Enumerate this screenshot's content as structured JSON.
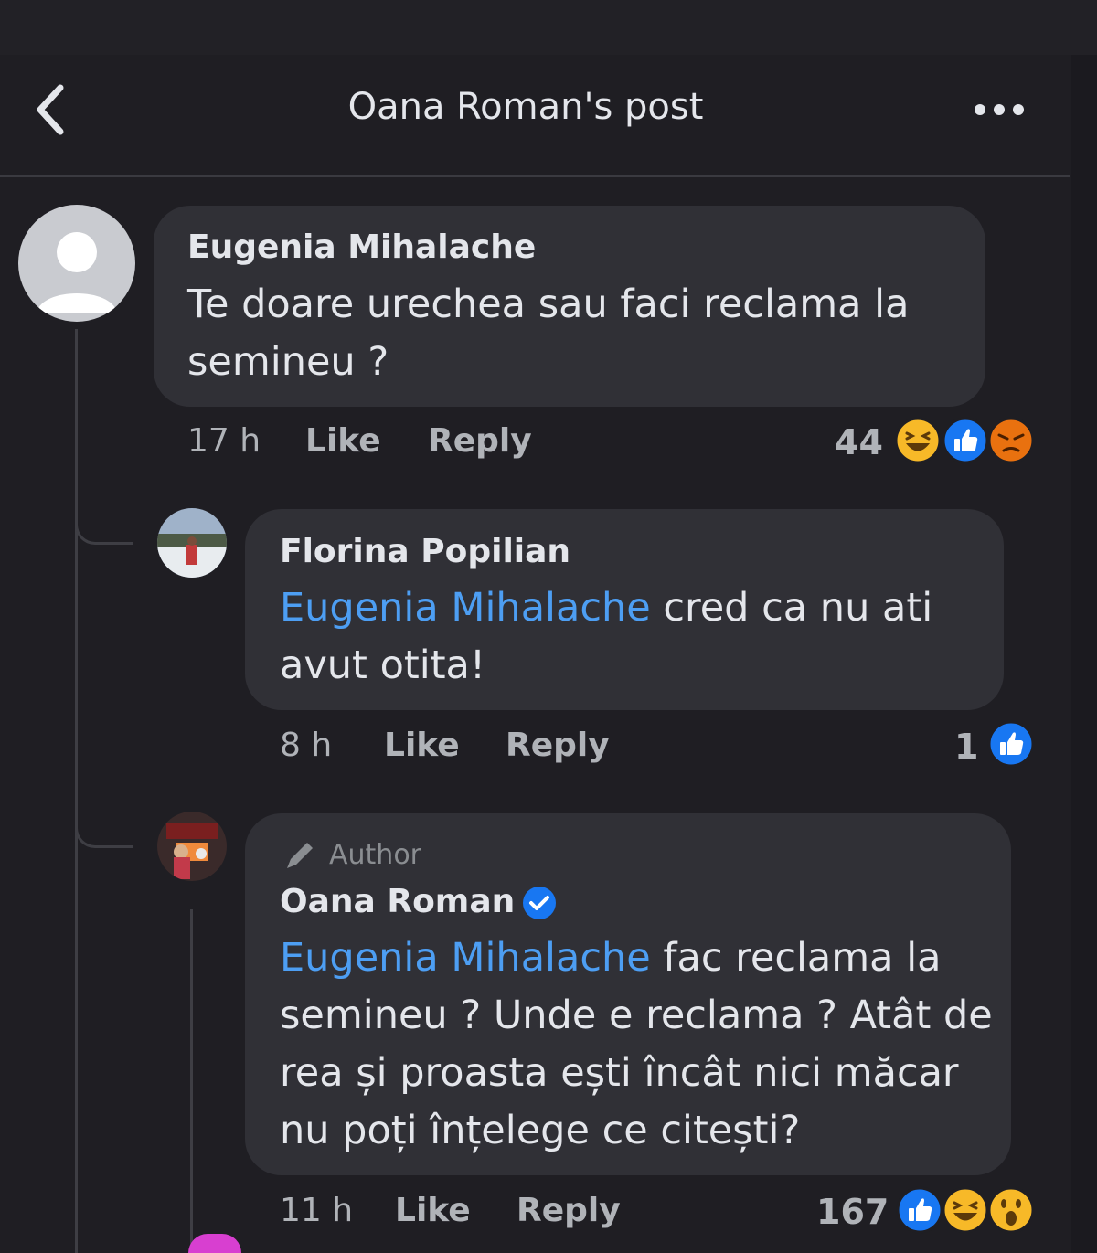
{
  "header": {
    "title": "Oana Roman's post"
  },
  "comments": [
    {
      "author": "Eugenia Mihalache",
      "text": "Te doare urechea sau faci reclama la semineu ?",
      "time": "17 h",
      "like_label": "Like",
      "reply_label": "Reply",
      "reaction_count": "44",
      "reactions": [
        "haha",
        "like",
        "angry"
      ]
    },
    {
      "author": "Florina Popilian",
      "mention": "Eugenia Mihalache",
      "text": " cred ca nu ati avut otita!",
      "time": "8 h",
      "like_label": "Like",
      "reply_label": "Reply",
      "reaction_count": "1",
      "reactions": [
        "like"
      ]
    },
    {
      "badge": "Author",
      "author": "Oana Roman",
      "verified": true,
      "mention": "Eugenia Mihalache",
      "text": " fac reclama la semineu ? Unde e reclama ? Atât de rea și proasta ești încât nici măcar nu poți înțelege ce citești?",
      "time": "11 h",
      "like_label": "Like",
      "reply_label": "Reply",
      "reaction_count": "167",
      "reactions": [
        "like",
        "haha",
        "wow"
      ]
    }
  ],
  "colors": {
    "background": "#1f1e23",
    "bubble": "#303036",
    "mention": "#4d9ef3",
    "like_blue": "#1877f2",
    "haha_yellow": "#f7b928",
    "angry_orange": "#e9710f"
  }
}
